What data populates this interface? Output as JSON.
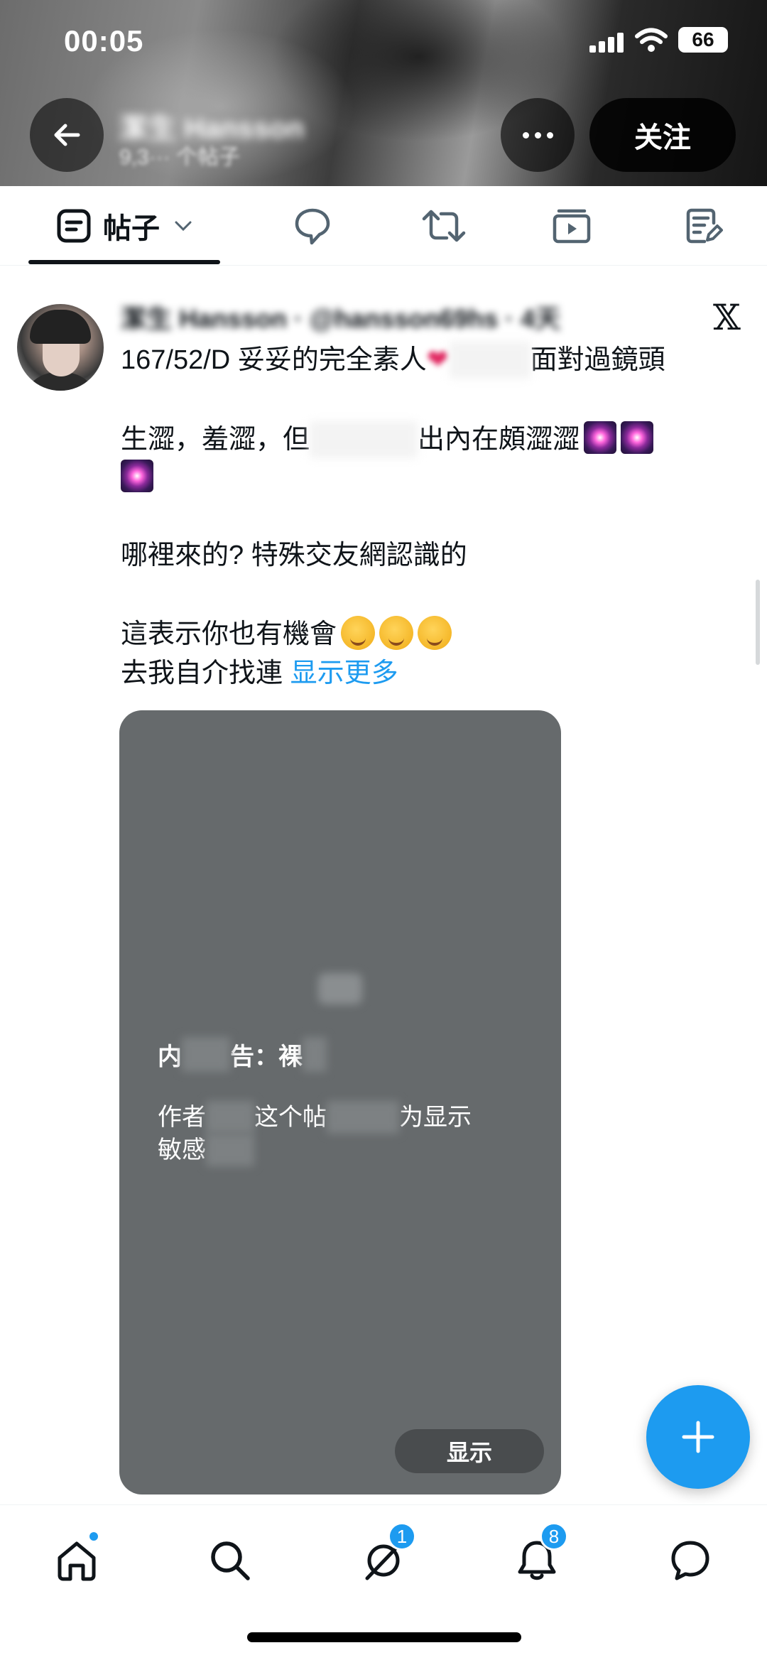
{
  "status_bar": {
    "time": "00:05",
    "battery": "66"
  },
  "profile_header": {
    "name": "潔生 Hansson",
    "subtitle": "9,3··· 个帖子",
    "follow_label": "关注"
  },
  "tabs": {
    "posts_label": "帖子"
  },
  "post": {
    "author_line": "潔生 Hansson · @hansson69hs · 4天",
    "lines": [
      {
        "id": "l1",
        "text": "167/52/D  妥妥的完全素人"
      },
      {
        "id": "l1b",
        "text": "面對過鏡頭"
      },
      {
        "id": "l2a",
        "text": "生澀，羞澀，但"
      },
      {
        "id": "l2b",
        "text": "出內在頗澀澀"
      },
      {
        "id": "l3",
        "text": "哪裡來的?  特殊交友網認識的"
      },
      {
        "id": "l4",
        "text": "這表示你也有機會"
      },
      {
        "id": "l5",
        "text": "去我自介找連"
      }
    ],
    "show_more": "显示更多"
  },
  "media": {
    "warning_title_a": "内",
    "warning_title_b": "告：裸",
    "warning_desc_a": "作者",
    "warning_desc_b": "这个帖",
    "warning_desc_c": "为显示",
    "warning_desc_d": "敏感",
    "reveal_label": "显示"
  },
  "bottom_nav": {
    "messages_badge": "1",
    "notifications_badge": "8"
  },
  "colors": {
    "accent": "#1d9bf0",
    "text": "#0f1419",
    "media_bg": "#666a6c"
  }
}
